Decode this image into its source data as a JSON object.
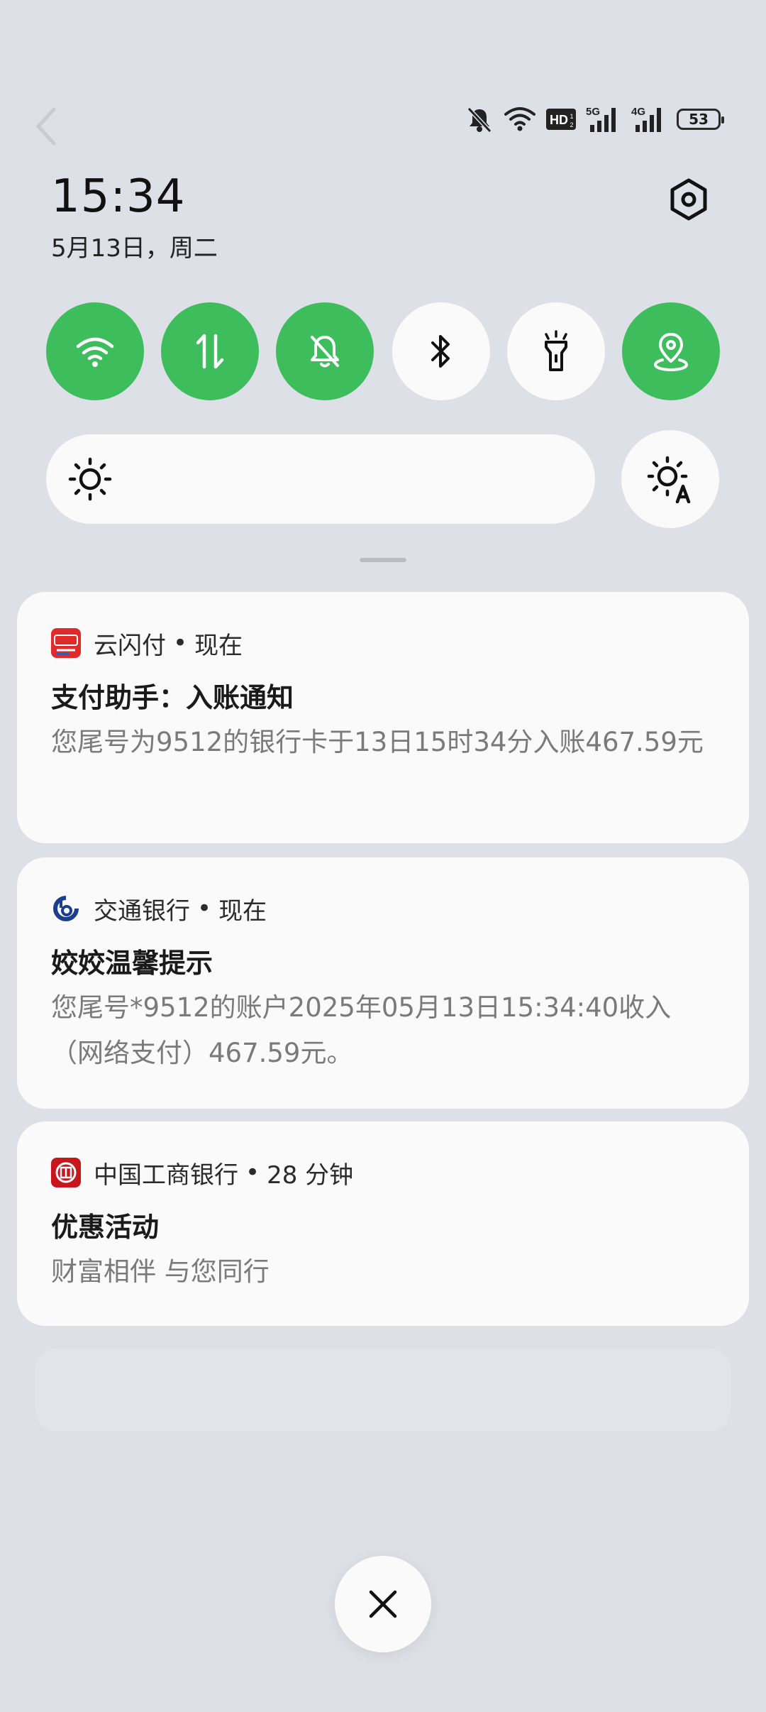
{
  "status_bar": {
    "battery": "53",
    "signal_1_label": "5G",
    "signal_2_label": "4G",
    "hd_label": "HD"
  },
  "header": {
    "time": "15:34",
    "date": "5月13日，周二"
  },
  "quick_toggles": [
    {
      "name": "wifi",
      "active": true
    },
    {
      "name": "mobile-data",
      "active": true
    },
    {
      "name": "silent",
      "active": true
    },
    {
      "name": "bluetooth",
      "active": false
    },
    {
      "name": "flashlight",
      "active": false
    },
    {
      "name": "location",
      "active": true
    }
  ],
  "colors": {
    "accent": "#3ebd5c",
    "background": "#dde0e6",
    "card": "#fafafa"
  },
  "notifications": [
    {
      "app": "云闪付",
      "time": "现在",
      "title": "支付助手：入账通知",
      "body": "您尾号为9512的银行卡于13日15时34分入账467.59元"
    },
    {
      "app": "交通银行",
      "time": "现在",
      "title": "姣姣温馨提示",
      "body": "您尾号*9512的账户2025年05月13日15:34:40收入（网络支付）467.59元。"
    },
    {
      "app": "中国工商银行",
      "time": "28 分钟",
      "title": "优惠活动",
      "body": "财富相伴 与您同行"
    }
  ],
  "separator": "•"
}
